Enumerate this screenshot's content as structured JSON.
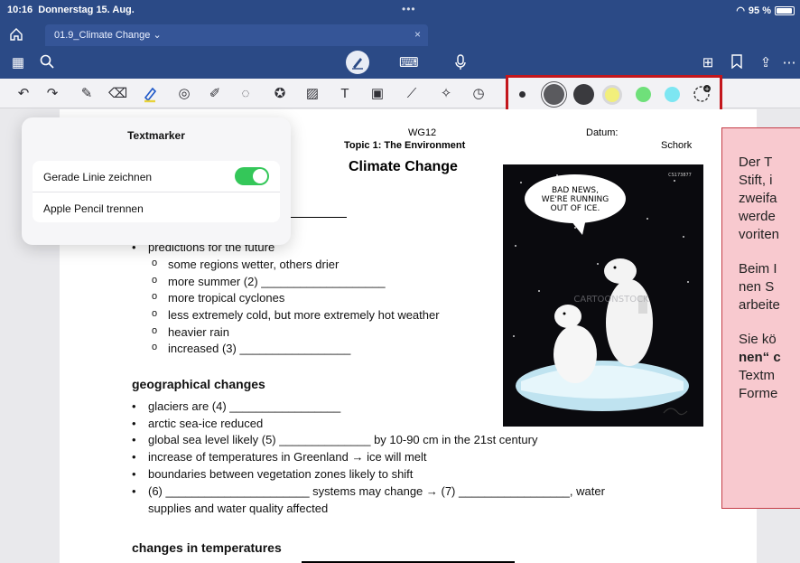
{
  "status": {
    "time": "10:16",
    "date": "Donnerstag 15. Aug.",
    "battery": "95 %"
  },
  "tab": {
    "title": "01.9_Climate Change",
    "dropdown_icon": "chevron-down-icon",
    "close_icon": "close-icon"
  },
  "popover": {
    "title": "Textmarker",
    "option1": "Gerade Linie zeichnen",
    "option1_on": true,
    "option2": "Apple Pencil trennen"
  },
  "doc": {
    "course": "WG12",
    "topic": "Topic 1: The Environment",
    "date_label": "Datum:",
    "teacher": "Schork",
    "title": "Climate Change",
    "predictions_header": "predictions for the future",
    "predictions": [
      "some regions wetter, others drier",
      "more summer (2) ___________________",
      "more tropical cyclones",
      "less extremely cold, but more extremely hot weather",
      "heavier rain",
      "increased (3) _________________"
    ],
    "geo_header": "geographical changes",
    "geo": [
      "glaciers are (4) _________________",
      "arctic sea-ice reduced",
      "global sea level likely (5) ______________ by 10-90 cm in the 21st century",
      "increase of temperatures in Greenland → ice will melt",
      "boundaries between vegetation zones likely to shift",
      "(6) ______________________ systems may change → (7) _________________, water",
      "supplies and water quality affected"
    ],
    "temp_header": "changes in temperatures"
  },
  "cartoon": {
    "speech": [
      "BAD NEWS,",
      "WE'RE RUNNING",
      "OUT OF ICE."
    ],
    "watermark": "CARTOONSTOCK",
    "code": "CS173877"
  },
  "note": {
    "p1": [
      "Der T",
      "Stift, i",
      "zweifa",
      "werde",
      "voriten"
    ],
    "p2": [
      "Beim I",
      "nen S",
      "arbeite"
    ],
    "p3": [
      "Sie kö",
      "nen“ c",
      "Textm",
      "Forme"
    ]
  },
  "palette": {
    "colors": [
      "#2f2f33",
      "#5a5a5e",
      "#3a3a3e",
      "#f2ef7b",
      "#6fe07a",
      "#7de6f2"
    ]
  }
}
